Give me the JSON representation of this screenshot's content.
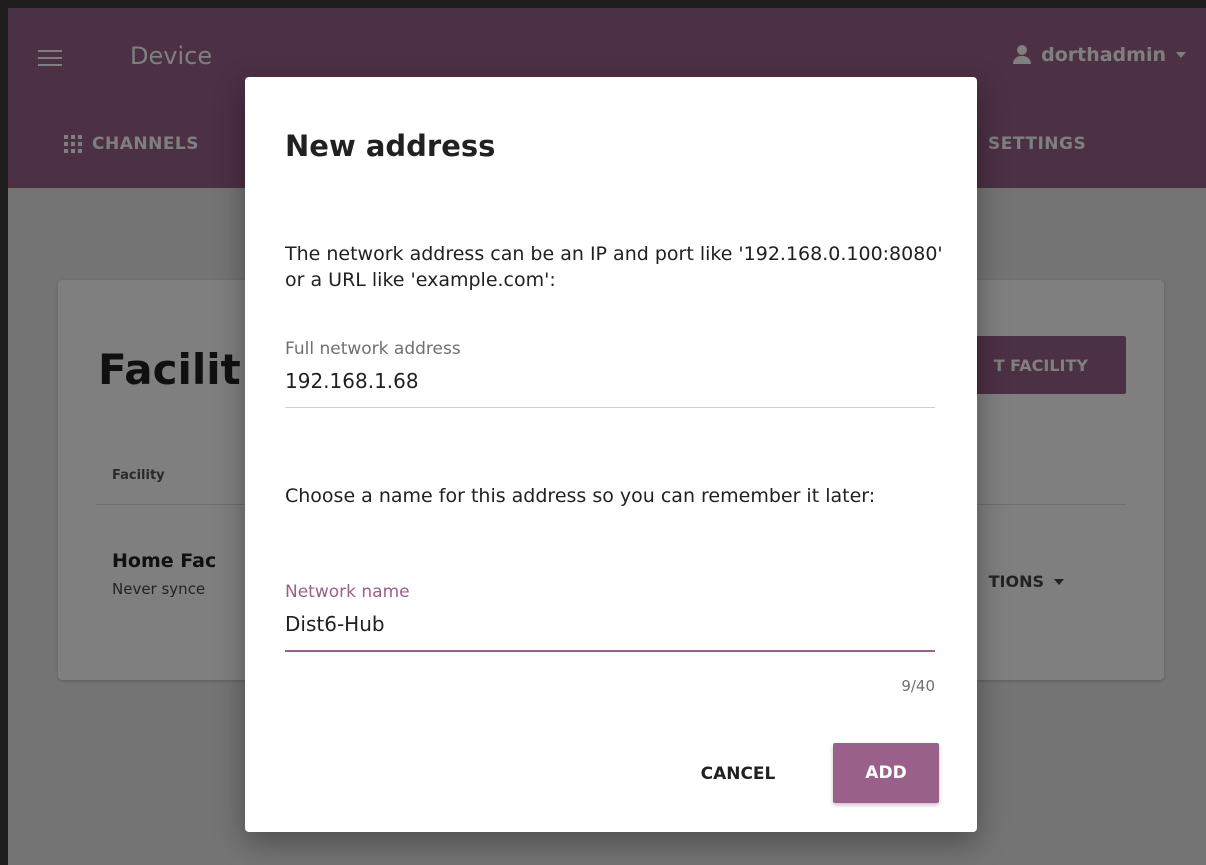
{
  "app": {
    "title": "Device",
    "user": "dorthadmin"
  },
  "nav": {
    "channels": "CHANNELS",
    "settings": "SETTINGS"
  },
  "background_card": {
    "title": "Facilit",
    "import_button": "T FACILITY",
    "column_header": "Facility",
    "row_name": "Home Fac",
    "row_sub": "Never synce",
    "options": "TIONS"
  },
  "dialog": {
    "title": "New address",
    "description": "The network address can be an IP and port like '192.168.0.100:8080' or a URL like 'example.com':",
    "address_label": "Full network address",
    "address_value": "192.168.1.68",
    "name_prompt": "Choose a name for this address so you can remember it later:",
    "name_label": "Network name",
    "name_value": "Dist6-Hub",
    "counter": "9/40",
    "cancel": "CANCEL",
    "add": "ADD"
  },
  "colors": {
    "accent": "#996189"
  }
}
